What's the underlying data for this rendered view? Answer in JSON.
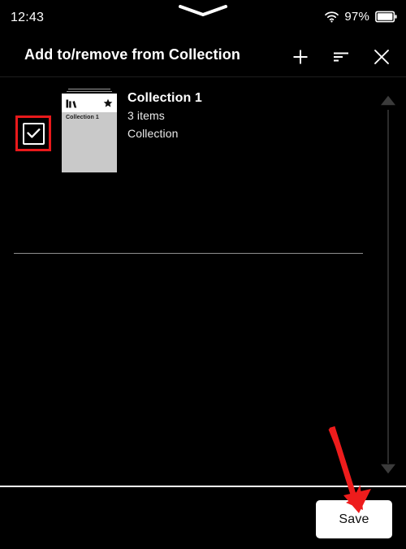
{
  "status_bar": {
    "time": "12:43",
    "battery_percent": "97%",
    "wifi_icon": "wifi-icon",
    "battery_icon": "battery-icon",
    "notch_icon": "chevron-down-notch-icon"
  },
  "header": {
    "title": "Add to/remove from Collection",
    "actions": [
      {
        "name": "add-collection-button",
        "icon": "plus-icon"
      },
      {
        "name": "sort-button",
        "icon": "sort-lines-icon"
      },
      {
        "name": "close-button",
        "icon": "close-x-icon"
      }
    ]
  },
  "list": {
    "items": [
      {
        "title": "Collection 1",
        "count": "3 items",
        "type": "Collection",
        "checked": true,
        "thumbnail_label": "Collection 1",
        "thumbnail_icons": [
          "books-icon",
          "star-icon"
        ]
      }
    ]
  },
  "scrollbar": {
    "up_arrow_icon": "caret-up-icon",
    "down_arrow_icon": "caret-down-icon"
  },
  "bottom_bar": {
    "save_label": "Save"
  },
  "annotations": {
    "arrow_color": "#ee1c1c",
    "highlight_color": "#e8191b",
    "arrow_target": "save-button",
    "highlight_target": "collection-checkbox"
  }
}
